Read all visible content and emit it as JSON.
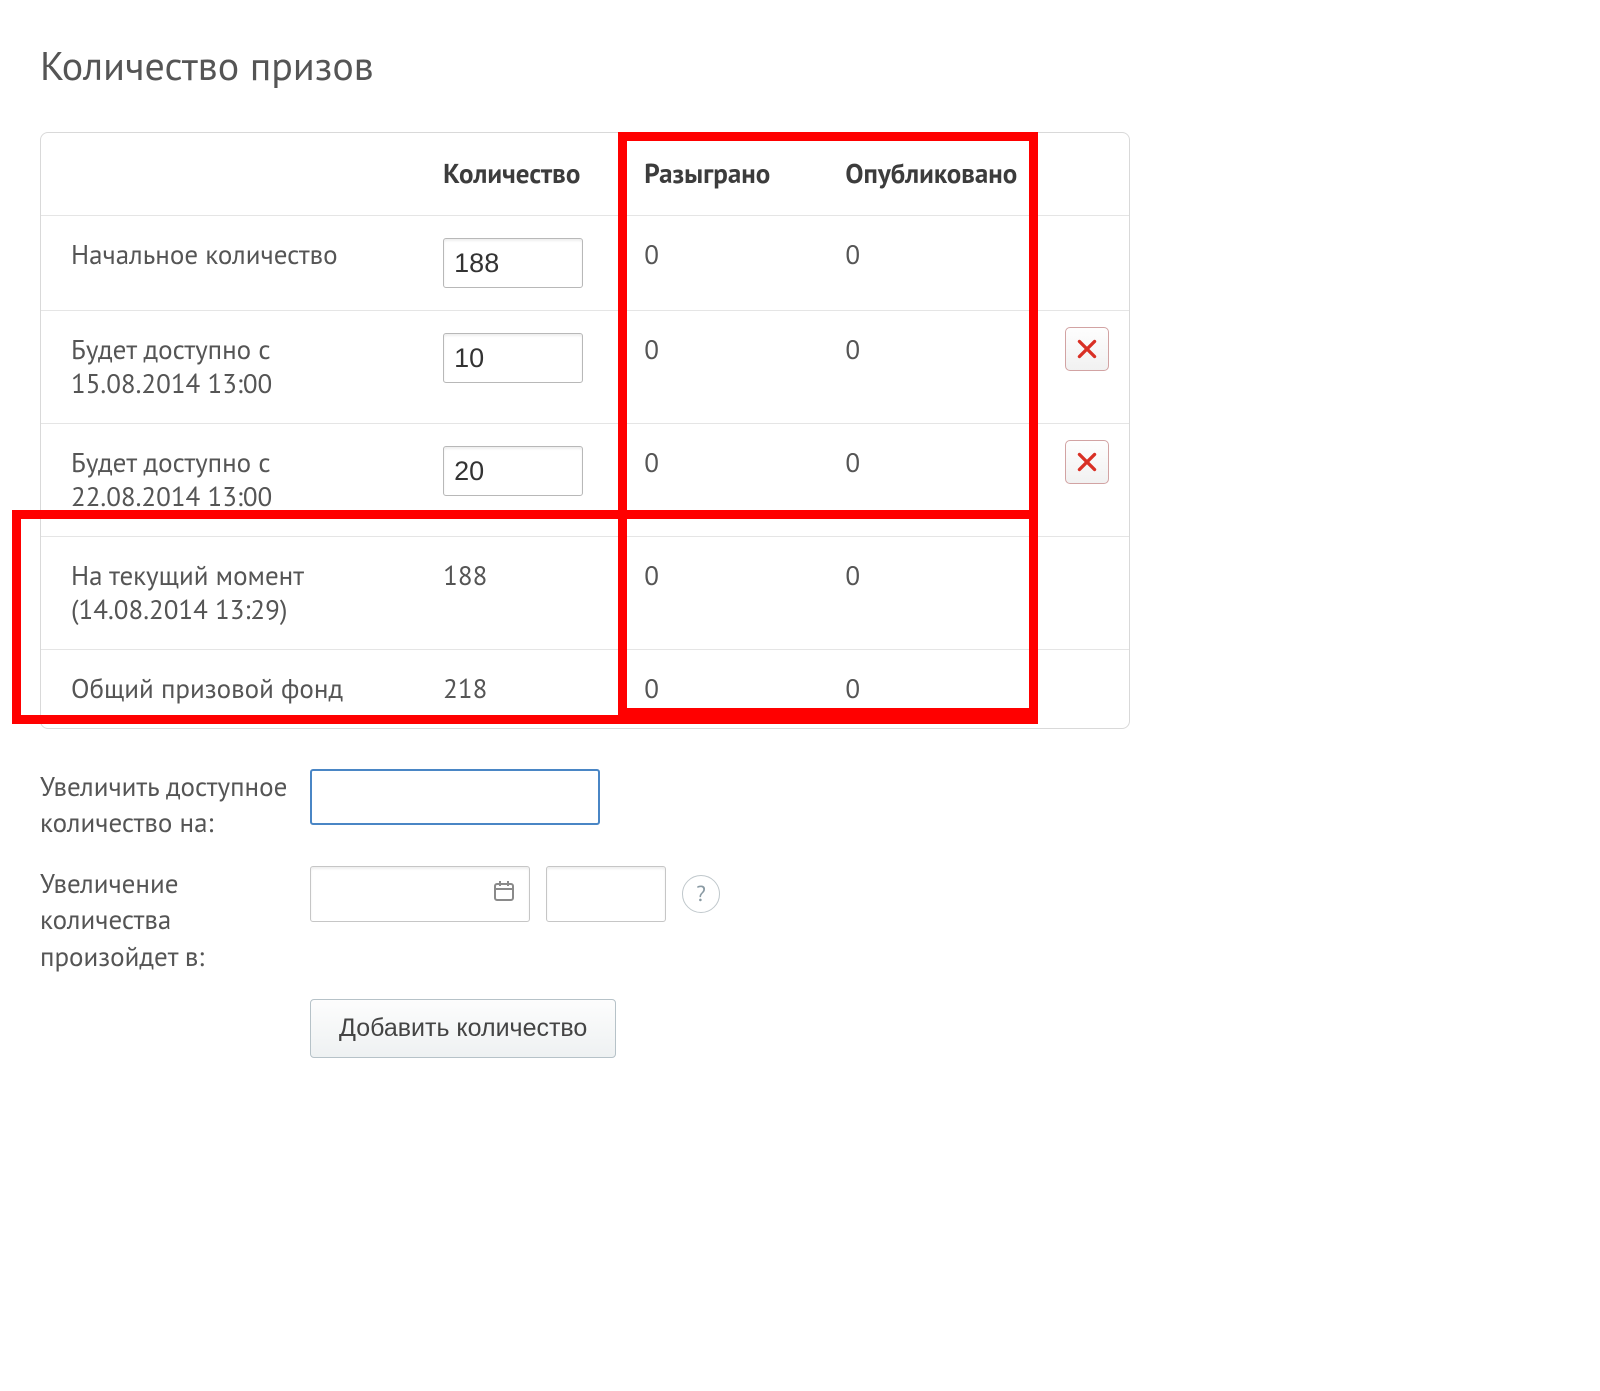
{
  "title": "Количество призов",
  "columns": {
    "label": "",
    "quantity": "Количество",
    "drawn": "Разыграно",
    "published": "Опубликовано"
  },
  "rows": [
    {
      "label": "Начальное количество",
      "quantity": "188",
      "quantity_editable": true,
      "drawn": "0",
      "published": "0",
      "deletable": false
    },
    {
      "label": "Будет доступно с 15.08.2014 13:00",
      "quantity": "10",
      "quantity_editable": true,
      "drawn": "0",
      "published": "0",
      "deletable": true
    },
    {
      "label": "Будет доступно с 22.08.2014 13:00",
      "quantity": "20",
      "quantity_editable": true,
      "drawn": "0",
      "published": "0",
      "deletable": true
    },
    {
      "label": "На текущий момент (14.08.2014 13:29)",
      "quantity": "188",
      "quantity_editable": false,
      "drawn": "0",
      "published": "0",
      "deletable": false
    },
    {
      "label": "Общий призовой фонд",
      "quantity": "218",
      "quantity_editable": false,
      "drawn": "0",
      "published": "0",
      "deletable": false
    }
  ],
  "form": {
    "increase_label": "Увеличить доступное количество на:",
    "increase_value": "",
    "schedule_label": "Увеличение количества произойдет в:",
    "date_value": "",
    "time_value": "",
    "help": "?",
    "button": "Добавить количество"
  }
}
